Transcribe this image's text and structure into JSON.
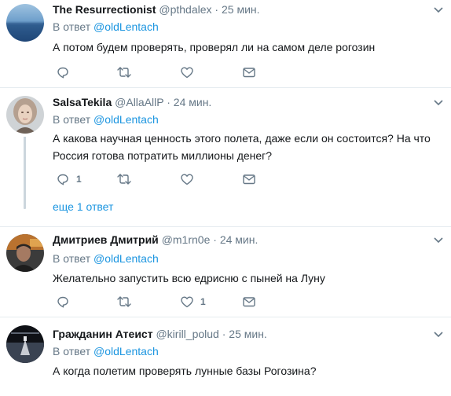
{
  "tweets": [
    {
      "name": "The Resurrectionist",
      "handle": "@pthdalex",
      "dot": "·",
      "time": "25 мин.",
      "reply_prefix": "В ответ",
      "reply_mention": "@oldLentach",
      "text": "А потом будем проверять, проверял ли на самом деле рогозин",
      "reply_count": "",
      "retweet_count": "",
      "like_count": ""
    },
    {
      "name": "SalsaTekila",
      "handle": "@AllaAllP",
      "dot": "·",
      "time": "24 мин.",
      "reply_prefix": "В ответ",
      "reply_mention": "@oldLentach",
      "text": "А какова научная ценность этого полета, даже если он состоится? На что Россия готова потратить миллионы денег?",
      "reply_count": "1",
      "retweet_count": "",
      "like_count": "",
      "more_replies": "еще 1 ответ"
    },
    {
      "name": "Дмитриев Дмитрий",
      "handle": "@m1rn0e",
      "dot": "·",
      "time": "24 мин.",
      "reply_prefix": "В ответ",
      "reply_mention": "@oldLentach",
      "text": "Желательно запустить всю едрисню с пыней на Луну",
      "reply_count": "",
      "retweet_count": "",
      "like_count": "1"
    },
    {
      "name": "Гражданин Атеист",
      "handle": "@kirill_polud",
      "dot": "·",
      "time": "25 мин.",
      "reply_prefix": "В ответ",
      "reply_mention": "@oldLentach",
      "text": "А когда полетим проверять лунные базы Рогозина?",
      "reply_count": "",
      "retweet_count": "",
      "like_count": ""
    }
  ],
  "colors": {
    "text": "#14171a",
    "muted": "#657786",
    "link": "#1b95e0",
    "divider": "#e6ecf0",
    "icon": "#657786"
  },
  "icons": [
    "reply-icon",
    "retweet-icon",
    "like-icon",
    "message-icon",
    "chevron-down-icon"
  ]
}
